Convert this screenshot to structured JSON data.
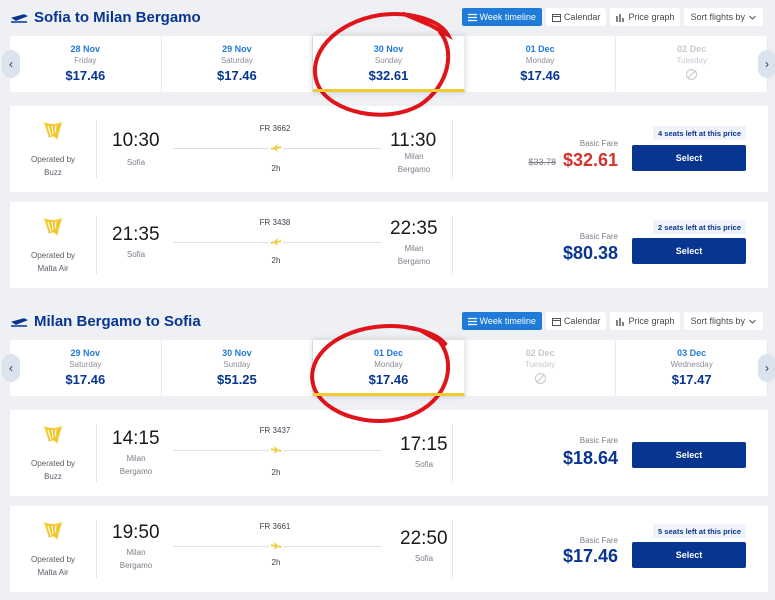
{
  "outbound": {
    "title": "Sofia to Milan Bergamo",
    "tabs": [
      "Week timeline",
      "Calendar",
      "Price graph",
      "Sort flights by"
    ],
    "dates": [
      {
        "date": "28 Nov",
        "weekday": "Friday",
        "price": "$17.46"
      },
      {
        "date": "29 Nov",
        "weekday": "Saturday",
        "price": "$17.46"
      },
      {
        "date": "30 Nov",
        "weekday": "Sunday",
        "price": "$32.61",
        "selected": true
      },
      {
        "date": "01 Dec",
        "weekday": "Monday",
        "price": "$17.46"
      },
      {
        "date": "02 Dec",
        "weekday": "Tuesday",
        "price": "",
        "disabled": true
      }
    ],
    "flights": [
      {
        "operator_label": "Operated by",
        "operator": "Buzz",
        "dep_time": "10:30",
        "dep_city": "Sofia",
        "flight_no": "FR 3662",
        "duration": "2h",
        "arr_time": "11:30",
        "arr_city_1": "Milan",
        "arr_city_2": "Bergamo",
        "fare_label": "Basic Fare",
        "old_price": "$33.78",
        "price": "$32.61",
        "seats": "4 seats left at this price",
        "select": "Select"
      },
      {
        "operator_label": "Operated by",
        "operator": "Malta Air",
        "dep_time": "21:35",
        "dep_city": "Sofia",
        "flight_no": "FR 3438",
        "duration": "2h",
        "arr_time": "22:35",
        "arr_city_1": "Milan",
        "arr_city_2": "Bergamo",
        "fare_label": "Basic Fare",
        "price": "$80.38",
        "seats": "2 seats left at this price",
        "select": "Select"
      }
    ]
  },
  "return": {
    "title": "Milan Bergamo to Sofia",
    "tabs": [
      "Week timeline",
      "Calendar",
      "Price graph",
      "Sort flights by"
    ],
    "dates": [
      {
        "date": "29 Nov",
        "weekday": "Saturday",
        "price": "$17.46"
      },
      {
        "date": "30 Nov",
        "weekday": "Sunday",
        "price": "$51.25"
      },
      {
        "date": "01 Dec",
        "weekday": "Monday",
        "price": "$17.46",
        "selected": true
      },
      {
        "date": "02 Dec",
        "weekday": "Tuesday",
        "price": "",
        "disabled": true
      },
      {
        "date": "03 Dec",
        "weekday": "Wednesday",
        "price": "$17.47"
      }
    ],
    "flights": [
      {
        "operator_label": "Operated by",
        "operator": "Buzz",
        "dep_time": "14:15",
        "dep_city_1": "Milan",
        "dep_city_2": "Bergamo",
        "flight_no": "FR 3437",
        "duration": "2h",
        "arr_time": "17:15",
        "arr_city": "Sofia",
        "fare_label": "Basic Fare",
        "price": "$18.64",
        "select": "Select"
      },
      {
        "operator_label": "Operated by",
        "operator": "Malta Air",
        "dep_time": "19:50",
        "dep_city_1": "Milan",
        "dep_city_2": "Bergamo",
        "flight_no": "FR 3661",
        "duration": "2h",
        "arr_time": "22:50",
        "arr_city": "Sofia",
        "fare_label": "Basic Fare",
        "price": "$17.46",
        "seats": "5 seats left at this price",
        "select": "Select"
      }
    ]
  },
  "colors": {
    "brand": "#073590",
    "accent": "#1f7ad8",
    "highlight": "#f1c933",
    "discount": "#d0342c",
    "annotation": "#e0151b"
  }
}
